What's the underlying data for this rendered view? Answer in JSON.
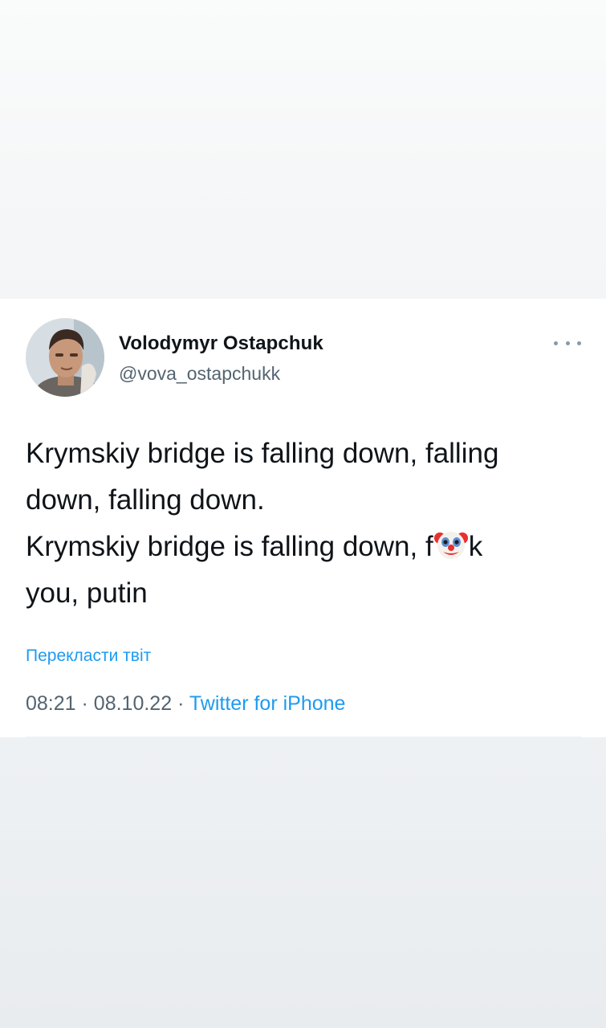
{
  "tweet": {
    "author": {
      "name": "Volodymyr Ostapchuk",
      "handle": "@vova_ostapchukk",
      "avatar_icon": "profile-photo"
    },
    "more_icon": "ellipsis-icon",
    "text": {
      "line1": "Krymskiy bridge is falling down, falling",
      "line2": "down, falling down.",
      "line3_before": "Krymskiy bridge is falling down, f",
      "line3_emoji": "clown-face-emoji",
      "line3_after": "k",
      "line4": "you, putin"
    },
    "translate_label": "Перекласти твіт",
    "time": "08:21",
    "separator": "·",
    "date": "08.10.22",
    "source": "Twitter for iPhone"
  },
  "colors": {
    "text_primary": "#0f1419",
    "text_secondary": "#536471",
    "link": "#1d9bf0",
    "background": "#f3f5f7",
    "card": "#ffffff"
  }
}
